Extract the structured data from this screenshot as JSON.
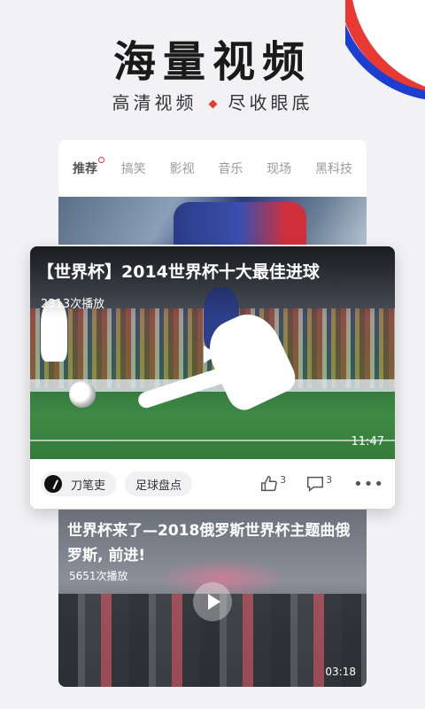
{
  "header": {
    "title": "海量视频",
    "subtitle_left": "高清视频",
    "subtitle_right": "尽收眼底"
  },
  "tabs": [
    {
      "label": "推荐",
      "active": true
    },
    {
      "label": "搞笑",
      "active": false
    },
    {
      "label": "影视",
      "active": false
    },
    {
      "label": "音乐",
      "active": false
    },
    {
      "label": "现场",
      "active": false
    },
    {
      "label": "黑科技",
      "active": false
    }
  ],
  "featured": {
    "title": "【世界杯】2014世界杯十大最佳进球",
    "views": "2313次播放",
    "duration": "11:47",
    "author": "刀笔吏",
    "tag": "足球盘点",
    "likes": "3",
    "comments": "3"
  },
  "second": {
    "title": "世界杯来了—2018俄罗斯世界杯主题曲俄罗斯, 前进!",
    "views": "5651次播放",
    "duration": "03:18"
  },
  "colors": {
    "accent_red": "#e53b2d",
    "flag_blue": "#1d3fd1"
  }
}
